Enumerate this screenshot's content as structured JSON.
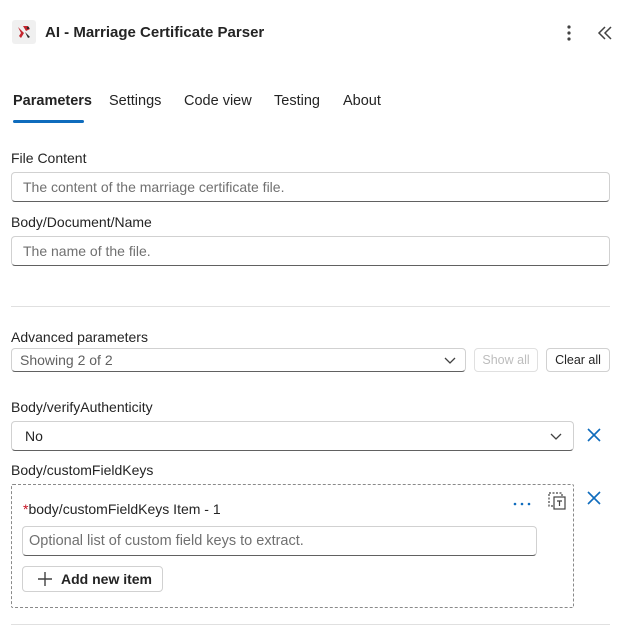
{
  "header": {
    "title": "AI - Marriage Certificate Parser",
    "logo_icon": "ai-connector-logo-icon",
    "more_icon": "more-vertical-icon",
    "collapse_icon": "double-chevron-left-icon"
  },
  "tabs": [
    {
      "label": "Parameters",
      "active": true
    },
    {
      "label": "Settings",
      "active": false
    },
    {
      "label": "Code view",
      "active": false
    },
    {
      "label": "Testing",
      "active": false
    },
    {
      "label": "About",
      "active": false
    }
  ],
  "fields": {
    "file_content": {
      "label": "File Content",
      "placeholder": "The content of the marriage certificate file."
    },
    "document_name": {
      "label": "Body/Document/Name",
      "placeholder": "The name of the file."
    }
  },
  "advanced": {
    "label": "Advanced parameters",
    "selected": "Showing 2 of 2",
    "show_all_label": "Show all",
    "clear_all_label": "Clear all"
  },
  "verify_authenticity": {
    "label": "Body/verifyAuthenticity",
    "value": "No"
  },
  "custom_field_keys": {
    "label": "Body/customFieldKeys",
    "item_label": "body/customFieldKeys Item - 1",
    "required_marker": "*",
    "item_placeholder": "Optional list of custom field keys to extract.",
    "add_label": "Add new item"
  },
  "colors": {
    "accent": "#0f6cbd",
    "required": "#c50f1f"
  }
}
